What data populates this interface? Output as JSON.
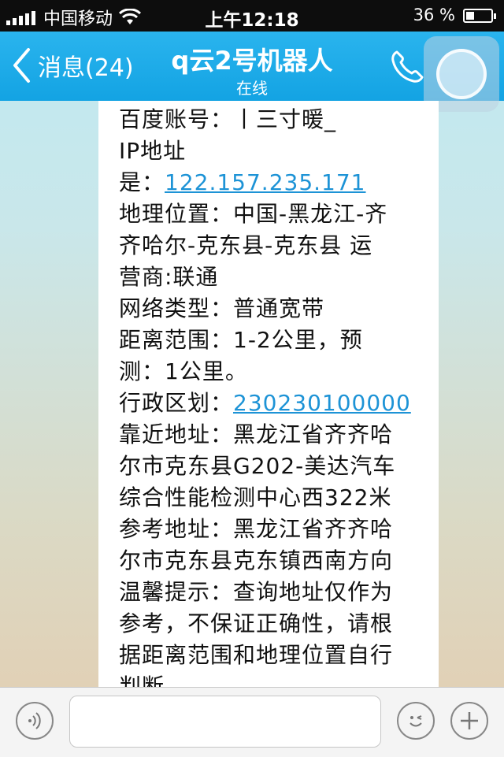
{
  "status_bar": {
    "carrier": "中国移动",
    "time": "上午12:18",
    "battery_percent": "36 %",
    "battery_level": 0.36
  },
  "nav": {
    "back_label": "消息(24)",
    "title": "q云2号机器人",
    "subtitle": "在线"
  },
  "message": {
    "lines": [
      {
        "text": "百度账号：丨三寸暖_"
      },
      {
        "text": "IP地址"
      },
      {
        "text": "是：",
        "link": "122.157.235.171"
      },
      {
        "text": "地理位置：中国-黑龙江-齐"
      },
      {
        "text": "齐哈尔-克东县-克东县 运"
      },
      {
        "text": "营商:联通"
      },
      {
        "text": "网络类型：普通宽带"
      },
      {
        "text": "距离范围：1-2公里，预"
      },
      {
        "text": "测：1公里。"
      },
      {
        "text": "行政区划：",
        "link": "230230100000"
      },
      {
        "text": "靠近地址：黑龙江省齐齐哈"
      },
      {
        "text": "尔市克东县G202-美达汽车"
      },
      {
        "text": "综合性能检测中心西322米"
      },
      {
        "text": "参考地址：黑龙江省齐齐哈"
      },
      {
        "text": "尔市克东县克东镇西南方向"
      },
      {
        "text": "温馨提示：查询地址仅作为"
      },
      {
        "text": "参考，不保证正确性，请根"
      },
      {
        "text": "据距离范围和地理位置自行"
      },
      {
        "text": "判断"
      }
    ]
  },
  "input": {
    "placeholder": "",
    "value": ""
  },
  "icons": {
    "voice": "voice-icon",
    "emoji": "emoji-icon",
    "plus": "plus-icon",
    "phone": "phone-icon",
    "back": "chevron-left-icon"
  },
  "colors": {
    "nav_blue": "#1aabe9",
    "link_blue": "#1d93d6"
  }
}
